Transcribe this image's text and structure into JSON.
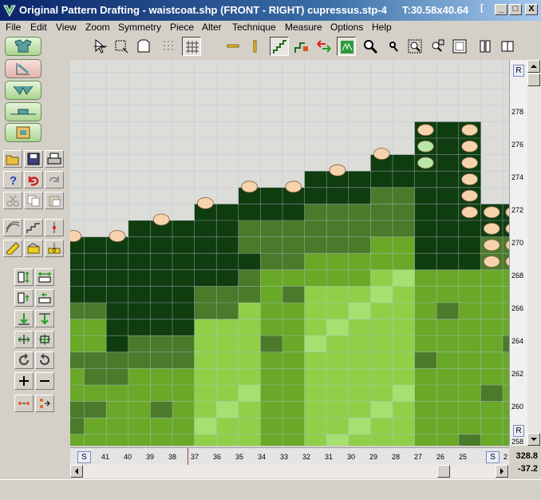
{
  "window": {
    "title": "Original Pattern Drafting - waistcoat.shp (FRONT - RIGHT)  cupressus.stp-4",
    "size_readout": "T:30.58x40.64",
    "buttons": {
      "minimize": "_",
      "maximize": "□",
      "close": "X",
      "restore": "["
    }
  },
  "menu": [
    "File",
    "Edit",
    "View",
    "Zoom",
    "Symmetry",
    "Piece",
    "Alter",
    "Technique",
    "Measure",
    "Options",
    "Help"
  ],
  "toolbar_icons": [
    "select-arrow-icon",
    "select-box-icon",
    "shirt-outline-icon",
    "grid-dots-icon",
    "grid-lines-icon",
    "dash-horizontal-icon",
    "dash-vertical-icon",
    "staircase-icon",
    "staircase-color-icon",
    "swap-arrows-icon",
    "pattern-view-icon",
    "zoom-icon",
    "zoom-small-icon",
    "zoom-in-region-icon",
    "zoom-out-region-icon",
    "fit-page-icon",
    "mirror-front-icon",
    "mirror-back-icon"
  ],
  "ruler_right": {
    "labels": [
      "278",
      "276",
      "274",
      "272",
      "270",
      "268",
      "266",
      "264",
      "262",
      "260",
      "258"
    ],
    "top_badge": "R",
    "bottom_badge": "R"
  },
  "ruler_bottom": {
    "labels": [
      "41",
      "40",
      "39",
      "38",
      "37",
      "36",
      "35",
      "34",
      "33",
      "32",
      "31",
      "30",
      "29",
      "28",
      "27",
      "26",
      "25",
      "2"
    ],
    "left_badge": "S",
    "right_badge": "S"
  },
  "coords": {
    "x": "328.8",
    "y": "-37.2"
  },
  "colors": {
    "darkest": "#0f3d0f",
    "dark": "#1e5a1e",
    "mid_dark": "#4a7a2a",
    "mid": "#6aa828",
    "light": "#8fd048",
    "lightest": "#a6e070",
    "background": "#dcdcd8",
    "bead": "#f7d3ad",
    "bead_green": "#b8e8a8"
  }
}
